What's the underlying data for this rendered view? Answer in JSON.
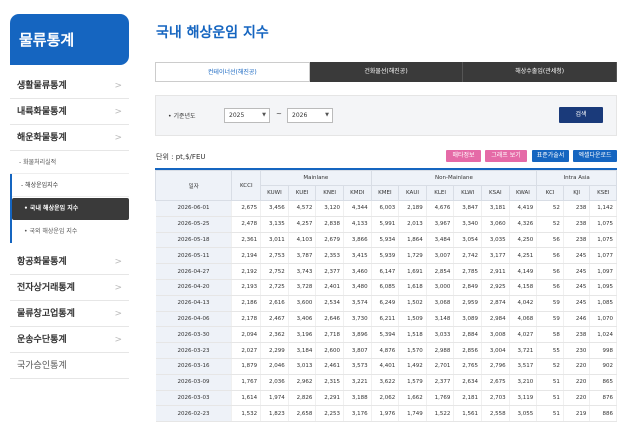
{
  "sidebar": {
    "header": "물류통계",
    "items_top": [
      "생활물류통계",
      "내륙화물통계",
      "해운화물통계"
    ],
    "sub_items": [
      "- 화물처리실적",
      "- 해상운임지수"
    ],
    "sub2_items": [
      "• 국내 해상운임 지수",
      "• 국외 해상운임 지수"
    ],
    "items_bottom": [
      "항공화물통계",
      "전자상거래통계",
      "물류창고업통계",
      "운송수단통계",
      "국가승인통계"
    ]
  },
  "page": {
    "title": "국내 해상운임 지수"
  },
  "tabs": [
    "컨테이너선(해진공)",
    "건화물선(해진공)",
    "해상수출입(관세청)"
  ],
  "filter": {
    "label": "• 기준년도",
    "from_year": "2025",
    "to_year": "2026",
    "tilde": "~",
    "search_label": "검색"
  },
  "unit_label": "단위 : pt,$/FEU",
  "buttons": [
    {
      "label": "매타정보",
      "color": "#e56aa7"
    },
    {
      "label": "그래프 보기",
      "color": "#e56aa7"
    },
    {
      "label": "표준가술서",
      "color": "#1565c0"
    },
    {
      "label": "엑셀다운로드",
      "color": "#1565c0"
    }
  ],
  "table": {
    "group_headers": [
      "일자",
      "KCCI",
      "Mainlane",
      "Non-Mainlane",
      "Intra Asia"
    ],
    "sub_headers": [
      "KUWI",
      "KUEI",
      "KNEI",
      "KMDI",
      "KMEI",
      "KAUI",
      "KLEI",
      "KLWI",
      "KSAI",
      "KWAI",
      "KCI",
      "KJI",
      "KSEI"
    ],
    "rows": [
      [
        "2026-06-01",
        "2,675",
        "3,456",
        "4,572",
        "3,120",
        "4,344",
        "6,003",
        "2,189",
        "4,676",
        "3,847",
        "3,181",
        "4,419",
        "52",
        "238",
        "1,142"
      ],
      [
        "2026-05-25",
        "2,478",
        "3,135",
        "4,257",
        "2,838",
        "4,133",
        "5,991",
        "2,013",
        "3,967",
        "3,340",
        "3,060",
        "4,326",
        "52",
        "238",
        "1,075"
      ],
      [
        "2026-05-18",
        "2,361",
        "3,011",
        "4,103",
        "2,679",
        "3,866",
        "5,934",
        "1,864",
        "3,484",
        "3,054",
        "3,035",
        "4,250",
        "56",
        "238",
        "1,075"
      ],
      [
        "2026-05-11",
        "2,194",
        "2,753",
        "3,787",
        "2,353",
        "3,415",
        "5,939",
        "1,729",
        "3,007",
        "2,742",
        "3,177",
        "4,251",
        "56",
        "245",
        "1,077"
      ],
      [
        "2026-04-27",
        "2,192",
        "2,752",
        "3,743",
        "2,377",
        "3,460",
        "6,147",
        "1,691",
        "2,854",
        "2,785",
        "2,911",
        "4,149",
        "56",
        "245",
        "1,097"
      ],
      [
        "2026-04-20",
        "2,193",
        "2,725",
        "3,728",
        "2,401",
        "3,480",
        "6,085",
        "1,618",
        "3,000",
        "2,849",
        "2,925",
        "4,158",
        "56",
        "245",
        "1,095"
      ],
      [
        "2026-04-13",
        "2,186",
        "2,616",
        "3,600",
        "2,534",
        "3,574",
        "6,249",
        "1,502",
        "3,068",
        "2,959",
        "2,874",
        "4,042",
        "59",
        "245",
        "1,085"
      ],
      [
        "2026-04-06",
        "2,178",
        "2,467",
        "3,406",
        "2,646",
        "3,730",
        "6,211",
        "1,509",
        "3,148",
        "3,089",
        "2,984",
        "4,068",
        "59",
        "246",
        "1,070"
      ],
      [
        "2026-03-30",
        "2,094",
        "2,362",
        "3,196",
        "2,718",
        "3,896",
        "5,394",
        "1,518",
        "3,033",
        "2,884",
        "3,008",
        "4,027",
        "58",
        "238",
        "1,024"
      ],
      [
        "2026-03-23",
        "2,027",
        "2,299",
        "3,184",
        "2,600",
        "3,807",
        "4,876",
        "1,570",
        "2,988",
        "2,856",
        "3,004",
        "3,721",
        "55",
        "230",
        "998"
      ],
      [
        "2026-03-16",
        "1,879",
        "2,046",
        "3,013",
        "2,461",
        "3,573",
        "4,401",
        "1,492",
        "2,701",
        "2,765",
        "2,796",
        "3,517",
        "52",
        "220",
        "902"
      ],
      [
        "2026-03-09",
        "1,767",
        "2,036",
        "2,962",
        "2,315",
        "3,221",
        "3,622",
        "1,579",
        "2,377",
        "2,634",
        "2,675",
        "3,210",
        "51",
        "220",
        "865"
      ],
      [
        "2026-03-03",
        "1,614",
        "1,974",
        "2,826",
        "2,291",
        "3,188",
        "2,062",
        "1,662",
        "1,769",
        "2,181",
        "2,703",
        "3,119",
        "51",
        "220",
        "876"
      ],
      [
        "2026-02-23",
        "1,532",
        "1,823",
        "2,658",
        "2,253",
        "3,176",
        "1,976",
        "1,749",
        "1,522",
        "1,561",
        "2,558",
        "3,055",
        "51",
        "219",
        "886"
      ]
    ]
  }
}
